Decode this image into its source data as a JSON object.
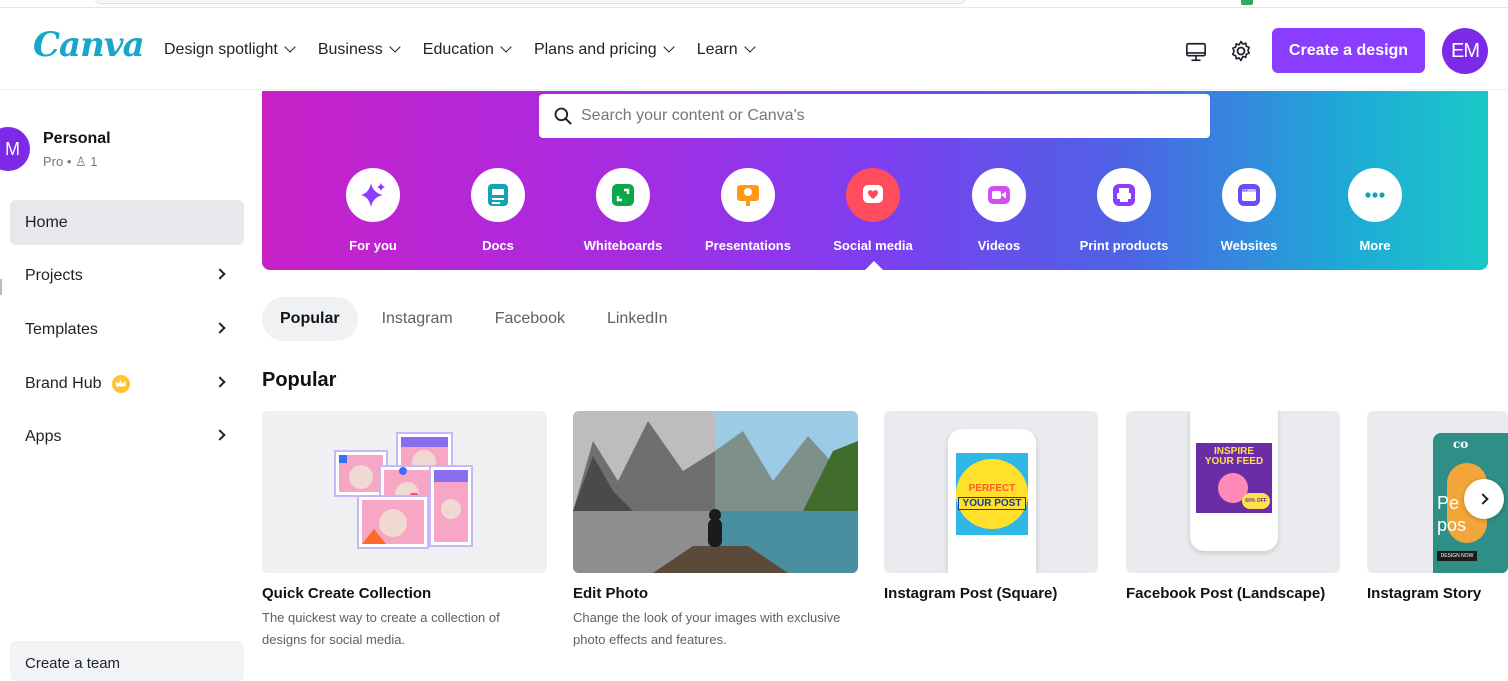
{
  "app": {
    "logo": "Canva"
  },
  "nav": {
    "items": [
      {
        "label": "Design spotlight"
      },
      {
        "label": "Business"
      },
      {
        "label": "Education"
      },
      {
        "label": "Plans and pricing"
      },
      {
        "label": "Learn"
      }
    ],
    "create_button": "Create a design",
    "avatar_initials": "EM"
  },
  "sidebar": {
    "account": {
      "initial": "M",
      "name": "Personal",
      "plan": "Pro • ♙ 1"
    },
    "items": [
      {
        "label": "Home",
        "active": true
      },
      {
        "label": "Projects"
      },
      {
        "label": "Templates"
      },
      {
        "label": "Brand Hub"
      },
      {
        "label": "Apps"
      }
    ],
    "create_team": "Create a team"
  },
  "hero": {
    "search_placeholder": "Search your content or Canva's",
    "categories": [
      {
        "label": "For you",
        "icon": "sparkle-icon",
        "color": "#8b3dff"
      },
      {
        "label": "Docs",
        "icon": "doc-icon",
        "color": "#13a3b5"
      },
      {
        "label": "Whiteboards",
        "icon": "whiteboard-icon",
        "color": "#0ba84a"
      },
      {
        "label": "Presentations",
        "icon": "presentation-icon",
        "color": "#ff9a17"
      },
      {
        "label": "Social media",
        "icon": "heart-icon",
        "color": "#ff4d5e"
      },
      {
        "label": "Videos",
        "icon": "video-icon",
        "color": "#d34df0"
      },
      {
        "label": "Print products",
        "icon": "printer-icon",
        "color": "#8b3dff"
      },
      {
        "label": "Websites",
        "icon": "website-icon",
        "color": "#6a4df5"
      },
      {
        "label": "More",
        "icon": "more-icon",
        "color": "#13a3b5"
      }
    ]
  },
  "tabs": [
    {
      "label": "Popular",
      "active": true
    },
    {
      "label": "Instagram"
    },
    {
      "label": "Facebook"
    },
    {
      "label": "LinkedIn"
    }
  ],
  "section": {
    "title": "Popular"
  },
  "cards": [
    {
      "title": "Quick Create Collection",
      "desc": "The quickest way to create a collection of designs for social media."
    },
    {
      "title": "Edit Photo",
      "desc": "Change the look of your images with exclusive photo effects and features."
    },
    {
      "title": "Instagram Post (Square)",
      "desc": "",
      "thumb_text": [
        "PERFECT",
        "YOUR POST"
      ]
    },
    {
      "title": "Facebook Post (Landscape)",
      "desc": "",
      "thumb_text": [
        "INSPIRE",
        "YOUR FEED",
        "60% OFF"
      ]
    },
    {
      "title": "Instagram Story",
      "desc": "",
      "thumb_text": [
        "co",
        "Pe",
        "pos",
        "DESIGN NOW"
      ]
    }
  ]
}
